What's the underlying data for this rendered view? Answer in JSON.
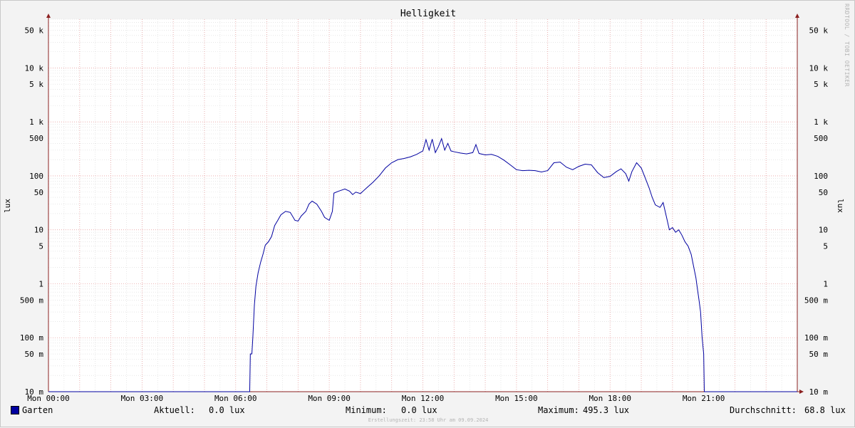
{
  "title": "Helligkeit",
  "watermark": "RRDTOOL / TOBI OETIKER",
  "ylabel_left": "lux",
  "ylabel_right": "lux",
  "legend": {
    "series_name": "Garten",
    "current_label": "Aktuell:",
    "current_value": "0.0 lux",
    "min_label": "Minimum:",
    "min_value": "0.0 lux",
    "max_label": "Maximum:",
    "max_value": "495.3 lux",
    "avg_label": "Durchschnitt:",
    "avg_value": "68.8 lux"
  },
  "footer": "Erstellungszeit: 23:58 Uhr am 09.09.2024",
  "colors": {
    "series": "#0000a0",
    "major_grid": "#e8a0a0",
    "minor_grid": "#d8d8d8",
    "plot_bg": "#ffffff",
    "axis": "#8b2020"
  },
  "chart_data": {
    "type": "line",
    "title": "Helligkeit",
    "xlabel": "",
    "ylabel": "lux",
    "yscale": "log",
    "ylim": [
      0.01,
      80000
    ],
    "xlim_hours": [
      0,
      24
    ],
    "x_ticks": [
      {
        "hour": 0,
        "label": "Mon 00:00"
      },
      {
        "hour": 3,
        "label": "Mon 03:00"
      },
      {
        "hour": 6,
        "label": "Mon 06:00"
      },
      {
        "hour": 9,
        "label": "Mon 09:00"
      },
      {
        "hour": 12,
        "label": "Mon 12:00"
      },
      {
        "hour": 15,
        "label": "Mon 15:00"
      },
      {
        "hour": 18,
        "label": "Mon 18:00"
      },
      {
        "hour": 21,
        "label": "Mon 21:00"
      }
    ],
    "y_ticks": [
      {
        "value": 50000,
        "label": "50 k"
      },
      {
        "value": 10000,
        "label": "10 k"
      },
      {
        "value": 5000,
        "label": "5 k"
      },
      {
        "value": 1000,
        "label": "1 k"
      },
      {
        "value": 500,
        "label": "500"
      },
      {
        "value": 100,
        "label": "100"
      },
      {
        "value": 50,
        "label": "50"
      },
      {
        "value": 10,
        "label": "10"
      },
      {
        "value": 5,
        "label": "5"
      },
      {
        "value": 1,
        "label": "1"
      },
      {
        "value": 0.5,
        "label": "500 m"
      },
      {
        "value": 0.1,
        "label": "100 m"
      },
      {
        "value": 0.05,
        "label": "50 m"
      },
      {
        "value": 0.01,
        "label": "10 m"
      }
    ],
    "grid": true,
    "series": [
      {
        "name": "Garten",
        "points": [
          [
            0.0,
            0.0
          ],
          [
            6.45,
            0.0
          ],
          [
            6.47,
            0.05
          ],
          [
            6.52,
            0.05
          ],
          [
            6.55,
            0.1
          ],
          [
            6.6,
            0.4
          ],
          [
            6.65,
            0.9
          ],
          [
            6.72,
            1.6
          ],
          [
            6.8,
            2.5
          ],
          [
            6.88,
            3.6
          ],
          [
            6.95,
            5.2
          ],
          [
            7.05,
            6.0
          ],
          [
            7.15,
            7.5
          ],
          [
            7.25,
            12
          ],
          [
            7.35,
            15
          ],
          [
            7.45,
            19
          ],
          [
            7.6,
            22
          ],
          [
            7.75,
            21
          ],
          [
            7.9,
            15
          ],
          [
            8.0,
            14.5
          ],
          [
            8.1,
            18
          ],
          [
            8.25,
            22
          ],
          [
            8.35,
            30
          ],
          [
            8.45,
            34
          ],
          [
            8.6,
            30
          ],
          [
            8.75,
            22
          ],
          [
            8.85,
            17
          ],
          [
            9.0,
            15
          ],
          [
            9.1,
            22
          ],
          [
            9.15,
            48
          ],
          [
            9.3,
            52
          ],
          [
            9.5,
            57
          ],
          [
            9.65,
            52
          ],
          [
            9.75,
            45
          ],
          [
            9.85,
            50
          ],
          [
            10.0,
            47
          ],
          [
            10.2,
            60
          ],
          [
            10.4,
            76
          ],
          [
            10.6,
            100
          ],
          [
            10.8,
            140
          ],
          [
            11.0,
            175
          ],
          [
            11.2,
            200
          ],
          [
            11.4,
            210
          ],
          [
            11.6,
            225
          ],
          [
            11.8,
            250
          ],
          [
            12.0,
            290
          ],
          [
            12.1,
            470
          ],
          [
            12.2,
            300
          ],
          [
            12.3,
            480
          ],
          [
            12.4,
            270
          ],
          [
            12.5,
            350
          ],
          [
            12.6,
            490
          ],
          [
            12.7,
            300
          ],
          [
            12.8,
            400
          ],
          [
            12.9,
            290
          ],
          [
            13.0,
            280
          ],
          [
            13.2,
            265
          ],
          [
            13.4,
            255
          ],
          [
            13.6,
            270
          ],
          [
            13.7,
            380
          ],
          [
            13.8,
            260
          ],
          [
            14.0,
            245
          ],
          [
            14.2,
            250
          ],
          [
            14.4,
            230
          ],
          [
            14.6,
            195
          ],
          [
            14.8,
            160
          ],
          [
            15.0,
            130
          ],
          [
            15.2,
            125
          ],
          [
            15.4,
            127
          ],
          [
            15.6,
            125
          ],
          [
            15.8,
            118
          ],
          [
            16.0,
            125
          ],
          [
            16.2,
            175
          ],
          [
            16.4,
            180
          ],
          [
            16.6,
            145
          ],
          [
            16.8,
            130
          ],
          [
            17.0,
            150
          ],
          [
            17.2,
            165
          ],
          [
            17.4,
            160
          ],
          [
            17.6,
            115
          ],
          [
            17.8,
            93
          ],
          [
            18.0,
            98
          ],
          [
            18.2,
            120
          ],
          [
            18.35,
            135
          ],
          [
            18.5,
            110
          ],
          [
            18.6,
            80
          ],
          [
            18.7,
            120
          ],
          [
            18.85,
            175
          ],
          [
            19.0,
            140
          ],
          [
            19.1,
            100
          ],
          [
            19.25,
            60
          ],
          [
            19.35,
            40
          ],
          [
            19.45,
            29
          ],
          [
            19.6,
            26
          ],
          [
            19.7,
            32
          ],
          [
            19.8,
            18
          ],
          [
            19.9,
            10
          ],
          [
            20.0,
            11
          ],
          [
            20.1,
            9
          ],
          [
            20.2,
            10
          ],
          [
            20.3,
            8
          ],
          [
            20.4,
            6
          ],
          [
            20.5,
            5
          ],
          [
            20.6,
            3.5
          ],
          [
            20.7,
            1.8
          ],
          [
            20.75,
            1.3
          ],
          [
            20.8,
            0.8
          ],
          [
            20.85,
            0.5
          ],
          [
            20.9,
            0.3
          ],
          [
            20.95,
            0.1
          ],
          [
            21.0,
            0.05
          ],
          [
            21.02,
            0.0
          ],
          [
            24.0,
            0.0
          ]
        ]
      }
    ]
  }
}
